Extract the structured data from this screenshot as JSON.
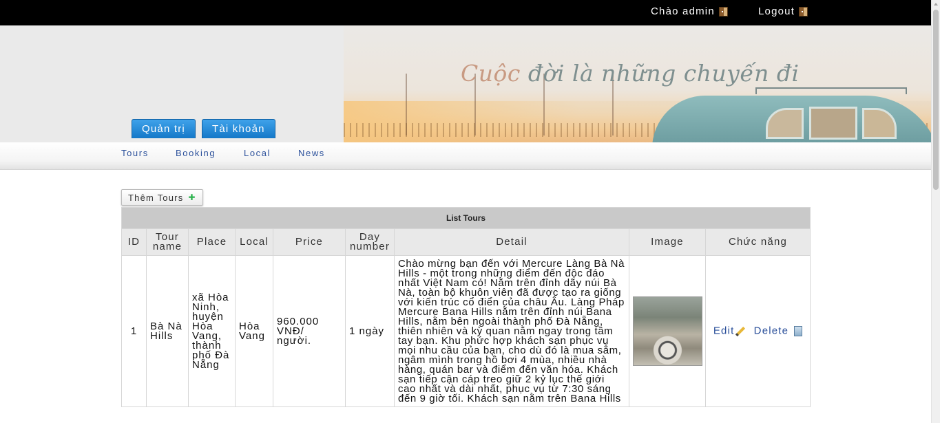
{
  "topbar": {
    "greeting": "Chào admin",
    "logout": "Logout"
  },
  "banner": {
    "slogan_first": "Cuộc",
    "slogan_rest": " đời là những chuyến đi"
  },
  "admin_tabs": [
    "Quản trị",
    "Tài khoản"
  ],
  "nav": [
    "Tours",
    "Booking",
    "Local",
    "News"
  ],
  "add_button": "Thêm Tours",
  "table": {
    "caption": "List Tours",
    "headers": [
      "ID",
      "Tour name",
      "Place",
      "Local",
      "Price",
      "Day number",
      "Detail",
      "Image",
      "Chức năng"
    ],
    "rows": [
      {
        "id": "1",
        "name": "Bà Nà Hills",
        "place": "xã Hòa Ninh, huyện Hòa Vang, thành phố Đà Nẵng",
        "local": "Hòa Vang",
        "price": "960.000 VNĐ/ người.",
        "days": "1 ngày",
        "detail": "Chào mừng bạn đến với Mercure Làng Bà Nà Hills - một trong những điểm đến độc đáo nhất Việt Nam có! Nằm trên đỉnh dãy núi Bà Nà, toàn bộ khuôn viên đã được tạo ra giống với kiến trúc cổ điển của châu Âu.    Làng Pháp Mercure Bana Hills nằm trên đỉnh núi Bana Hills, nằm bên ngoài thành phố Đà Nẵng, thiên nhiên và kỳ quan nằm ngay trong tầm tay bạn. Khu phức hợp khách sạn phục vụ mọi nhu cầu của bạn, cho dù đó là mua sắm, ngâm mình trong hồ bơi 4 mùa, nhiều nhà hàng, quán bar và điểm đến văn hóa. Khách sạn tiếp cận cáp treo giữ 2 kỷ lục thế giới cao nhất và dài nhất, phục vụ từ 7:30 sáng đến 9 giờ tối. Khách sạn nằm trên Bana Hills",
        "edit": "Edit",
        "delete": "Delete"
      }
    ]
  },
  "colors": {
    "topbar": "#000000",
    "tab_blue": "#1e88d8",
    "link": "#2a4f9a",
    "header_grey": "#c9c9c9"
  }
}
